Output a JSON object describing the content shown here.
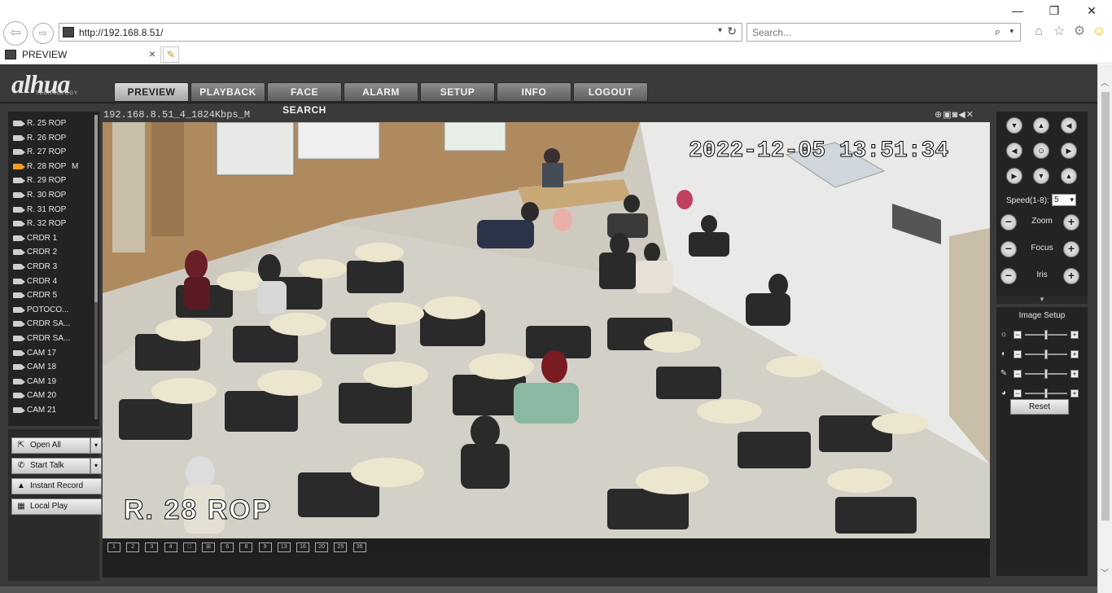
{
  "browser": {
    "url": "http://192.168.8.51/",
    "search_placeholder": "Search...",
    "tab_title": "PREVIEW"
  },
  "app": {
    "logo": "alhua",
    "logo_sub": "TECHNOLOGY",
    "nav": [
      "PREVIEW",
      "PLAYBACK",
      "FACE SEARCH",
      "ALARM",
      "SETUP",
      "INFO",
      "LOGOUT"
    ],
    "active_nav": "PREVIEW"
  },
  "channels": [
    {
      "label": "R. 25 ROP"
    },
    {
      "label": "R. 26 ROP"
    },
    {
      "label": "R. 27 ROP"
    },
    {
      "label": "R. 28 ROP",
      "flag": "M",
      "active": true
    },
    {
      "label": "R. 29 ROP"
    },
    {
      "label": "R. 30 ROP"
    },
    {
      "label": "R. 31 ROP"
    },
    {
      "label": "R. 32 ROP"
    },
    {
      "label": "CRDR 1"
    },
    {
      "label": "CRDR 2"
    },
    {
      "label": "CRDR 3"
    },
    {
      "label": "CRDR 4"
    },
    {
      "label": "CRDR 5"
    },
    {
      "label": "POTOCO..."
    },
    {
      "label": "CRDR SA..."
    },
    {
      "label": "CRDR SA..."
    },
    {
      "label": "CAM 17"
    },
    {
      "label": "CAM 18"
    },
    {
      "label": "CAM 19"
    },
    {
      "label": "CAM 20"
    },
    {
      "label": "CAM 21"
    }
  ],
  "actions": {
    "open_all": "Open All",
    "start_talk": "Start Talk",
    "instant_record": "Instant Record",
    "local_play": "Local Play"
  },
  "video": {
    "stream_label": "192.168.8.51_4_1824Kbps_M",
    "timestamp": "2022-12-05 13:51:34",
    "camera_name": "R. 28 ROP"
  },
  "layouts": [
    "1",
    "2",
    "3",
    "4",
    "□",
    "⊞",
    "6",
    "8",
    "9",
    "13",
    "16",
    "20",
    "25",
    "36"
  ],
  "ptz": {
    "speed_label": "Speed(1-8):",
    "speed_value": "5",
    "zoom": "Zoom",
    "focus": "Focus",
    "iris": "Iris"
  },
  "image_setup": {
    "title": "Image Setup",
    "reset": "Reset"
  }
}
